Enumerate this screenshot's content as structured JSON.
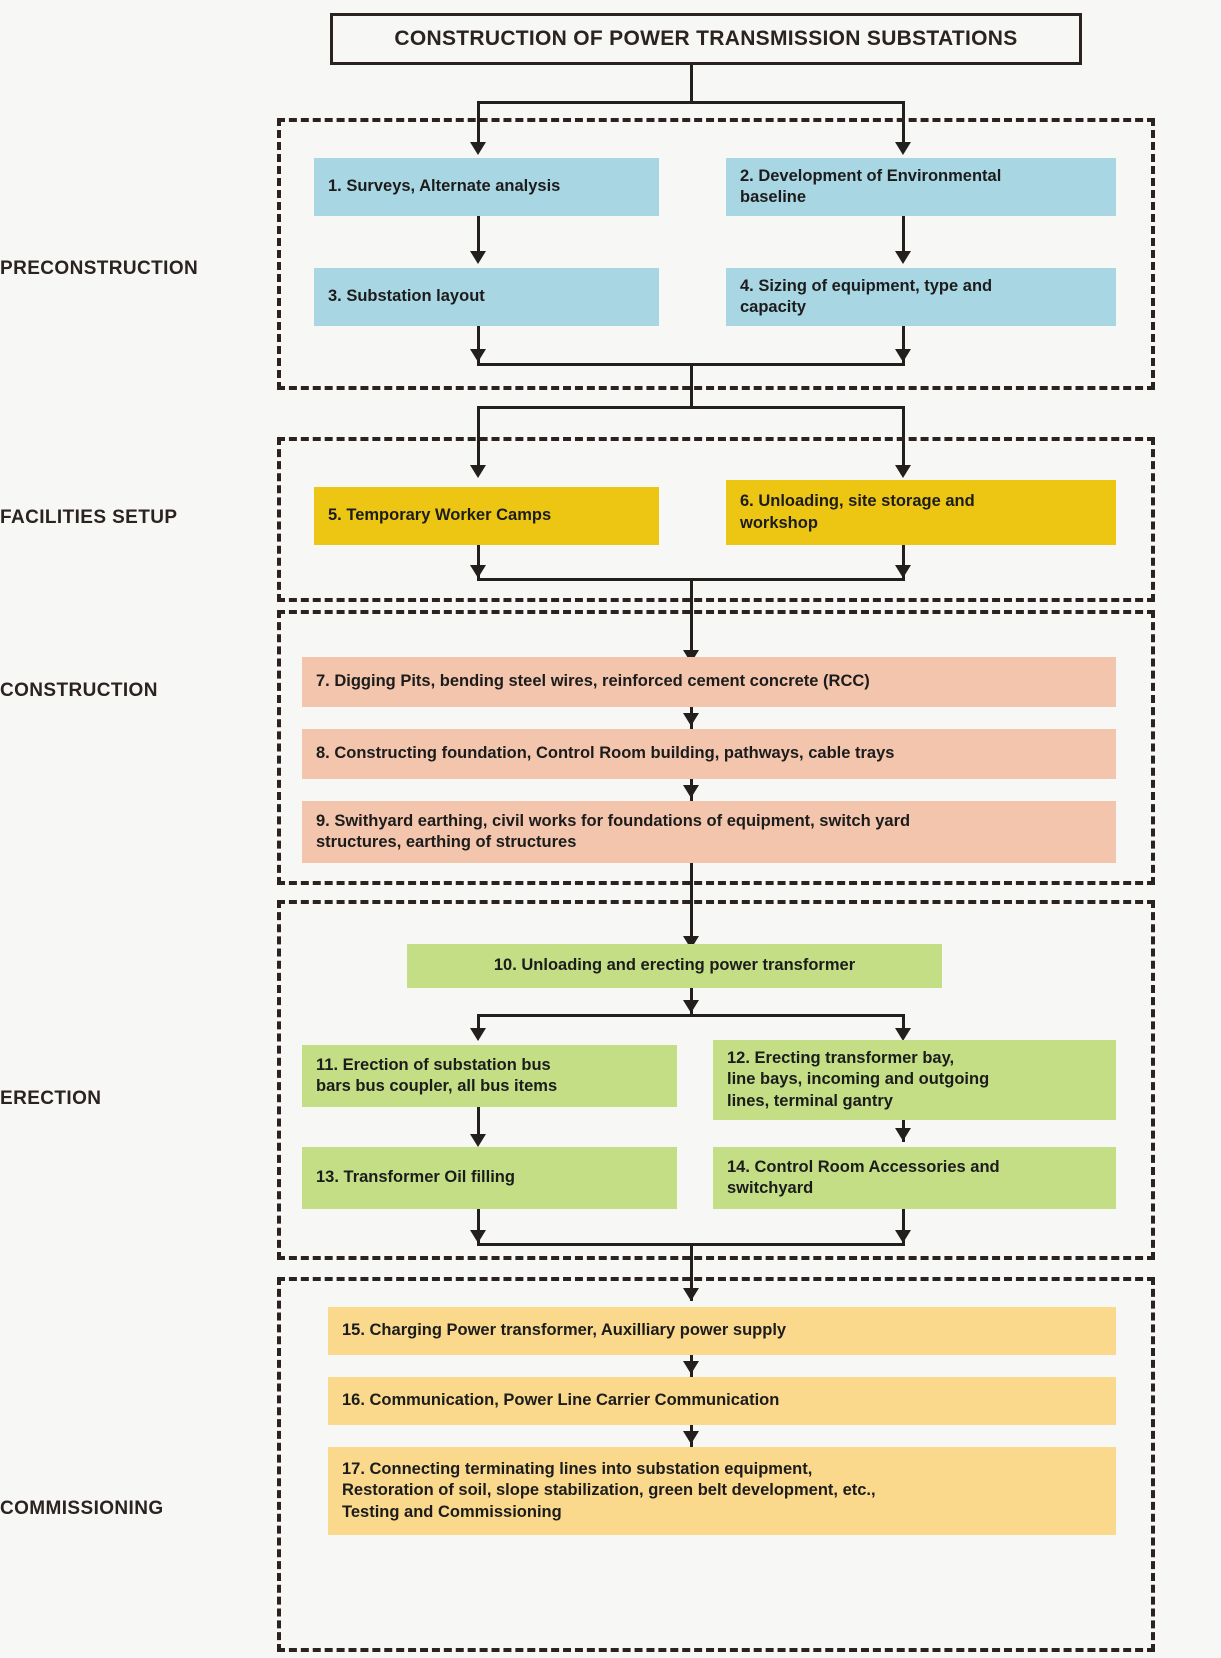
{
  "diagram": {
    "title": "CONSTRUCTION OF POWER TRANSMISSION SUBSTATIONS",
    "phases": [
      {
        "id": "preconstruction",
        "label": "PRECONSTRUCTION",
        "color": "#a9d6e3"
      },
      {
        "id": "facilities-setup",
        "label": "FACILITIES SETUP",
        "color": "#ecc613"
      },
      {
        "id": "construction",
        "label": "CONSTRUCTION",
        "color": "#f2c5ac"
      },
      {
        "id": "erection",
        "label": "ERECTION",
        "color": "#c3de85"
      },
      {
        "id": "commissioning",
        "label": "COMMISSIONING",
        "color": "#fad88c"
      }
    ],
    "steps": {
      "s1": "1. Surveys, Alternate analysis",
      "s2": "2. Development of Environmental\nbaseline",
      "s3": "3. Substation layout",
      "s4": "4. Sizing of equipment, type and\ncapacity",
      "s5": "5. Temporary Worker Camps",
      "s6": "6. Unloading, site storage and\nworkshop",
      "s7": "7. Digging Pits, bending steel wires, reinforced cement concrete (RCC)",
      "s8": "8. Constructing foundation, Control Room building, pathways, cable trays",
      "s9": "9. Swithyard earthing, civil works for foundations of equipment, switch yard\n     structures, earthing of structures",
      "s10": "10. Unloading and erecting power transformer",
      "s11": "11. Erection of substation bus\n      bars bus coupler, all bus items",
      "s12": "12. Erecting transformer bay,\n      line bays, incoming and outgoing\n      lines, terminal gantry",
      "s13": "13. Transformer Oil filling",
      "s14": "14. Control Room Accessories and\n      switchyard",
      "s15": "15. Charging Power transformer, Auxilliary power supply",
      "s16": "16. Communication, Power Line Carrier Communication",
      "s17": "17. Connecting terminating lines into substation equipment,\n      Restoration of soil, slope stabilization, green belt development, etc.,\n      Testing and Commissioning"
    },
    "colors": {
      "background": "#f7f7f5",
      "line": "#231f1c",
      "text": "#2b2320",
      "preconstruction": "#a9d6e3",
      "facilities": "#ecc613",
      "construction": "#f2c5ac",
      "erection": "#c3de85",
      "commissioning": "#fad88c"
    }
  }
}
